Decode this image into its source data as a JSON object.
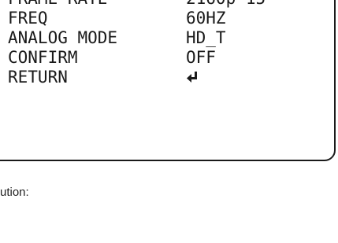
{
  "osd_menu": {
    "items": [
      {
        "label": "FRAME RATE",
        "value": "2160p 15"
      },
      {
        "label": "FREQ",
        "value": "60HZ"
      },
      {
        "label": "ANALOG MODE",
        "value": "HD_T"
      },
      {
        "label": "CONFIRM",
        "value": "OFF"
      },
      {
        "label": "RETURN",
        "value_icon": "return-arrow-icon"
      }
    ]
  },
  "caption": {
    "text": "ution:"
  }
}
